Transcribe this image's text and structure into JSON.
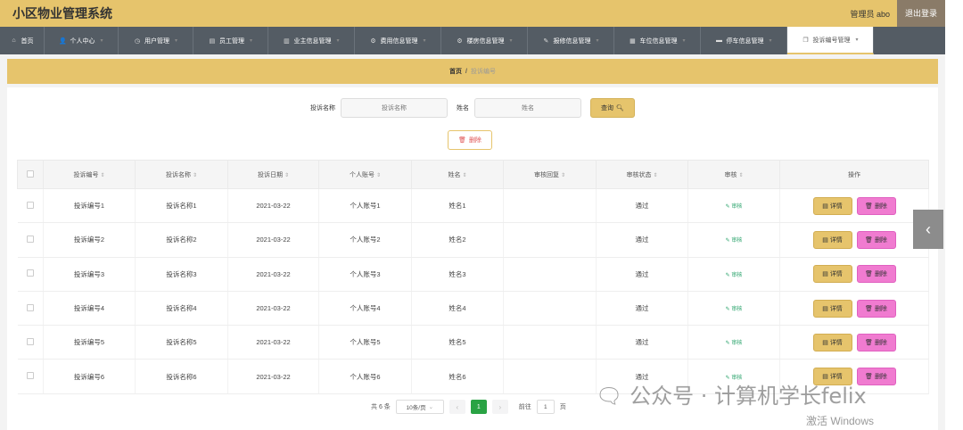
{
  "app": {
    "title": "小区物业管理系统",
    "admin": "管理员 abo",
    "logout": "退出登录"
  },
  "nav": [
    {
      "icon": "home-icon",
      "glyph": "⌂",
      "label": "首页",
      "caret": false,
      "width": 50
    },
    {
      "icon": "user-icon",
      "glyph": "👤",
      "label": "个人中心",
      "caret": true,
      "width": 83
    },
    {
      "icon": "clock-icon",
      "glyph": "◷",
      "label": "用户管理",
      "caret": true,
      "width": 84
    },
    {
      "icon": "folder-icon",
      "glyph": "▤",
      "label": "员工管理",
      "caret": true,
      "width": 84
    },
    {
      "icon": "chart-icon",
      "glyph": "▥",
      "label": "业主信息管理",
      "caret": true,
      "width": 97
    },
    {
      "icon": "gear-icon",
      "glyph": "⚙",
      "label": "费用信息管理",
      "caret": true,
      "width": 97
    },
    {
      "icon": "cog-icon",
      "glyph": "⚙",
      "label": "楼房信息管理",
      "caret": true,
      "width": 97
    },
    {
      "icon": "tool-icon",
      "glyph": "✎",
      "label": "报修信息管理",
      "caret": true,
      "width": 97
    },
    {
      "icon": "grid-icon",
      "glyph": "▦",
      "label": "车位信息管理",
      "caret": true,
      "width": 97
    },
    {
      "icon": "car-icon",
      "glyph": "▬",
      "label": "停车信息管理",
      "caret": true,
      "width": 97
    },
    {
      "icon": "copy-icon",
      "glyph": "❐",
      "label": "投诉编号管理",
      "caret": true,
      "width": 97,
      "active": true
    }
  ],
  "breadcrumb": {
    "home": "首页",
    "sep": "/",
    "current": "投诉编号"
  },
  "search": {
    "label1": "投诉名称",
    "placeholder1": "投诉名称",
    "label2": "姓名",
    "placeholder2": "姓名",
    "button": "查询"
  },
  "toolbar": {
    "delete": "删除"
  },
  "table": {
    "headers": [
      "投诉编号",
      "投诉名称",
      "投诉日期",
      "个人账号",
      "姓名",
      "审核回复",
      "审核状态",
      "审核",
      "操作"
    ],
    "rows": [
      {
        "code": "投诉编号1",
        "name": "投诉名称1",
        "date": "2021-03-22",
        "account": "个人账号1",
        "person": "姓名1",
        "reply": "",
        "status": "通过",
        "audit": "审核"
      },
      {
        "code": "投诉编号2",
        "name": "投诉名称2",
        "date": "2021-03-22",
        "account": "个人账号2",
        "person": "姓名2",
        "reply": "",
        "status": "通过",
        "audit": "审核"
      },
      {
        "code": "投诉编号3",
        "name": "投诉名称3",
        "date": "2021-03-22",
        "account": "个人账号3",
        "person": "姓名3",
        "reply": "",
        "status": "通过",
        "audit": "审核"
      },
      {
        "code": "投诉编号4",
        "name": "投诉名称4",
        "date": "2021-03-22",
        "account": "个人账号4",
        "person": "姓名4",
        "reply": "",
        "status": "通过",
        "audit": "审核"
      },
      {
        "code": "投诉编号5",
        "name": "投诉名称5",
        "date": "2021-03-22",
        "account": "个人账号5",
        "person": "姓名5",
        "reply": "",
        "status": "通过",
        "audit": "审核"
      },
      {
        "code": "投诉编号6",
        "name": "投诉名称6",
        "date": "2021-03-22",
        "account": "个人账号6",
        "person": "姓名6",
        "reply": "",
        "status": "通过",
        "audit": "审核"
      }
    ],
    "detail_label": "详情",
    "delete_label": "删除"
  },
  "pager": {
    "total": "共 6 条",
    "size": "10条/页",
    "current": "1",
    "goto": "前往",
    "goto_value": "1",
    "page_unit": "页"
  },
  "watermark": "🗨 公众号 · 计算机学长felix",
  "activate": "激活 Windows",
  "colors": {
    "primary": "#e6c46c",
    "nav": "#545c64",
    "delete": "#f07bd0",
    "page_active": "#2aa344"
  }
}
